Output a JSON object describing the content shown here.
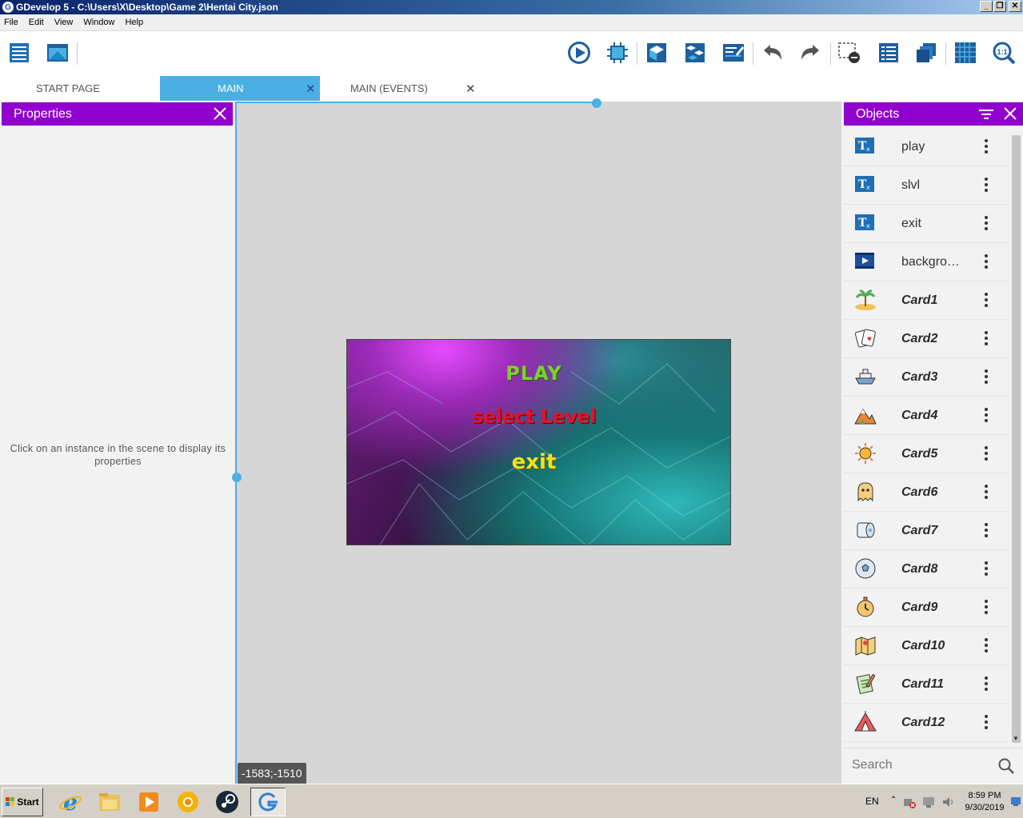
{
  "window": {
    "title": "GDevelop 5 - C:\\Users\\X\\Desktop\\Game 2\\Hentai City.json"
  },
  "menu": [
    "File",
    "Edit",
    "View",
    "Window",
    "Help"
  ],
  "toolbar": {
    "icons": [
      "project-manager-icon",
      "scene-icon",
      "preview-icon",
      "debugger-icon",
      "objects-icon",
      "object-groups-icon",
      "properties-icon",
      "undo-icon",
      "redo-icon",
      "delete-icon",
      "instances-list-icon",
      "layers-icon",
      "grid-icon",
      "zoom-icon"
    ]
  },
  "tabs": [
    {
      "label": "START PAGE",
      "closable": false
    },
    {
      "label": "MAIN",
      "closable": true,
      "active": true
    },
    {
      "label": "MAIN (EVENTS)",
      "closable": true
    }
  ],
  "properties": {
    "title": "Properties",
    "empty_message": "Click on an instance in the scene to display its properties"
  },
  "scene": {
    "play": "PLAY",
    "select_level": "select Level",
    "exit": "exit",
    "cursor_coords": "-1583;-1510"
  },
  "objects": {
    "title": "Objects",
    "search_placeholder": "Search",
    "items": [
      {
        "name": "play",
        "icon": "text-object-icon",
        "italic": false
      },
      {
        "name": "slvl",
        "icon": "text-object-icon",
        "italic": false
      },
      {
        "name": "exit",
        "icon": "text-object-icon",
        "italic": false
      },
      {
        "name": "backgro…",
        "icon": "tiled-sprite-icon",
        "italic": false
      },
      {
        "name": "Card1",
        "icon": "island-icon",
        "italic": true
      },
      {
        "name": "Card2",
        "icon": "playing-cards-icon",
        "italic": true
      },
      {
        "name": "Card3",
        "icon": "ship-icon",
        "italic": true
      },
      {
        "name": "Card4",
        "icon": "mountain-icon",
        "italic": true
      },
      {
        "name": "Card5",
        "icon": "sun-icon",
        "italic": true
      },
      {
        "name": "Card6",
        "icon": "ghost-icon",
        "italic": true
      },
      {
        "name": "Card7",
        "icon": "toilet-paper-icon",
        "italic": true
      },
      {
        "name": "Card8",
        "icon": "soccer-ball-icon",
        "italic": true
      },
      {
        "name": "Card9",
        "icon": "stopwatch-icon",
        "italic": true
      },
      {
        "name": "Card10",
        "icon": "map-icon",
        "italic": true
      },
      {
        "name": "Card11",
        "icon": "clipboard-icon",
        "italic": true
      },
      {
        "name": "Card12",
        "icon": "tent-icon",
        "italic": true
      }
    ]
  },
  "taskbar": {
    "start": "Start",
    "apps": [
      "internet-explorer-icon",
      "file-explorer-icon",
      "media-player-icon",
      "chrome-icon",
      "steam-icon",
      "gdevelop-icon"
    ],
    "language": "EN",
    "time": "8:59 PM",
    "date": "9/30/2019"
  },
  "colors": {
    "accent": "#4ab0e4",
    "panel_header": "#9100ce",
    "canvas_bg": "#d6d6d6"
  }
}
